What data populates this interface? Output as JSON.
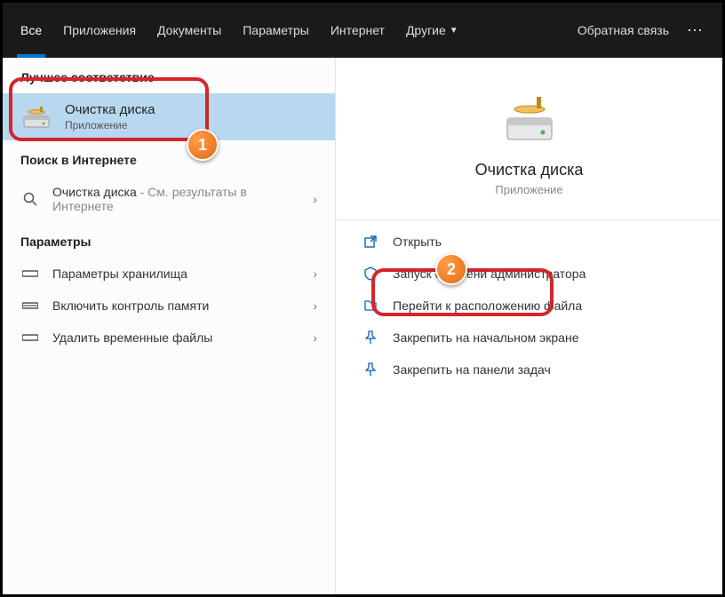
{
  "topbar": {
    "tabs": {
      "all": "Все",
      "apps": "Приложения",
      "docs": "Документы",
      "params": "Параметры",
      "internet": "Интернет",
      "other": "Другие"
    },
    "feedback": "Обратная связь"
  },
  "left": {
    "best_header": "Лучшее соответствие",
    "best": {
      "title": "Очистка диска",
      "sub": "Приложение"
    },
    "web_header": "Поиск в Интернете",
    "web_row": {
      "term": "Очистка диска",
      "suffix": " - См. результаты в",
      "line2": "Интернете"
    },
    "params_header": "Параметры",
    "params": {
      "storage": "Параметры хранилища",
      "memory": "Включить контроль памяти",
      "temp": "Удалить временные файлы"
    }
  },
  "right": {
    "title": "Очистка диска",
    "sub": "Приложение",
    "actions": {
      "open": "Открыть",
      "admin": "Запуск от имени администратора",
      "location": "Перейти к расположению файла",
      "pin_start": "Закрепить на начальном экране",
      "pin_task": "Закрепить на панели задач"
    }
  },
  "badges": {
    "one": "1",
    "two": "2"
  },
  "chevron": "›"
}
